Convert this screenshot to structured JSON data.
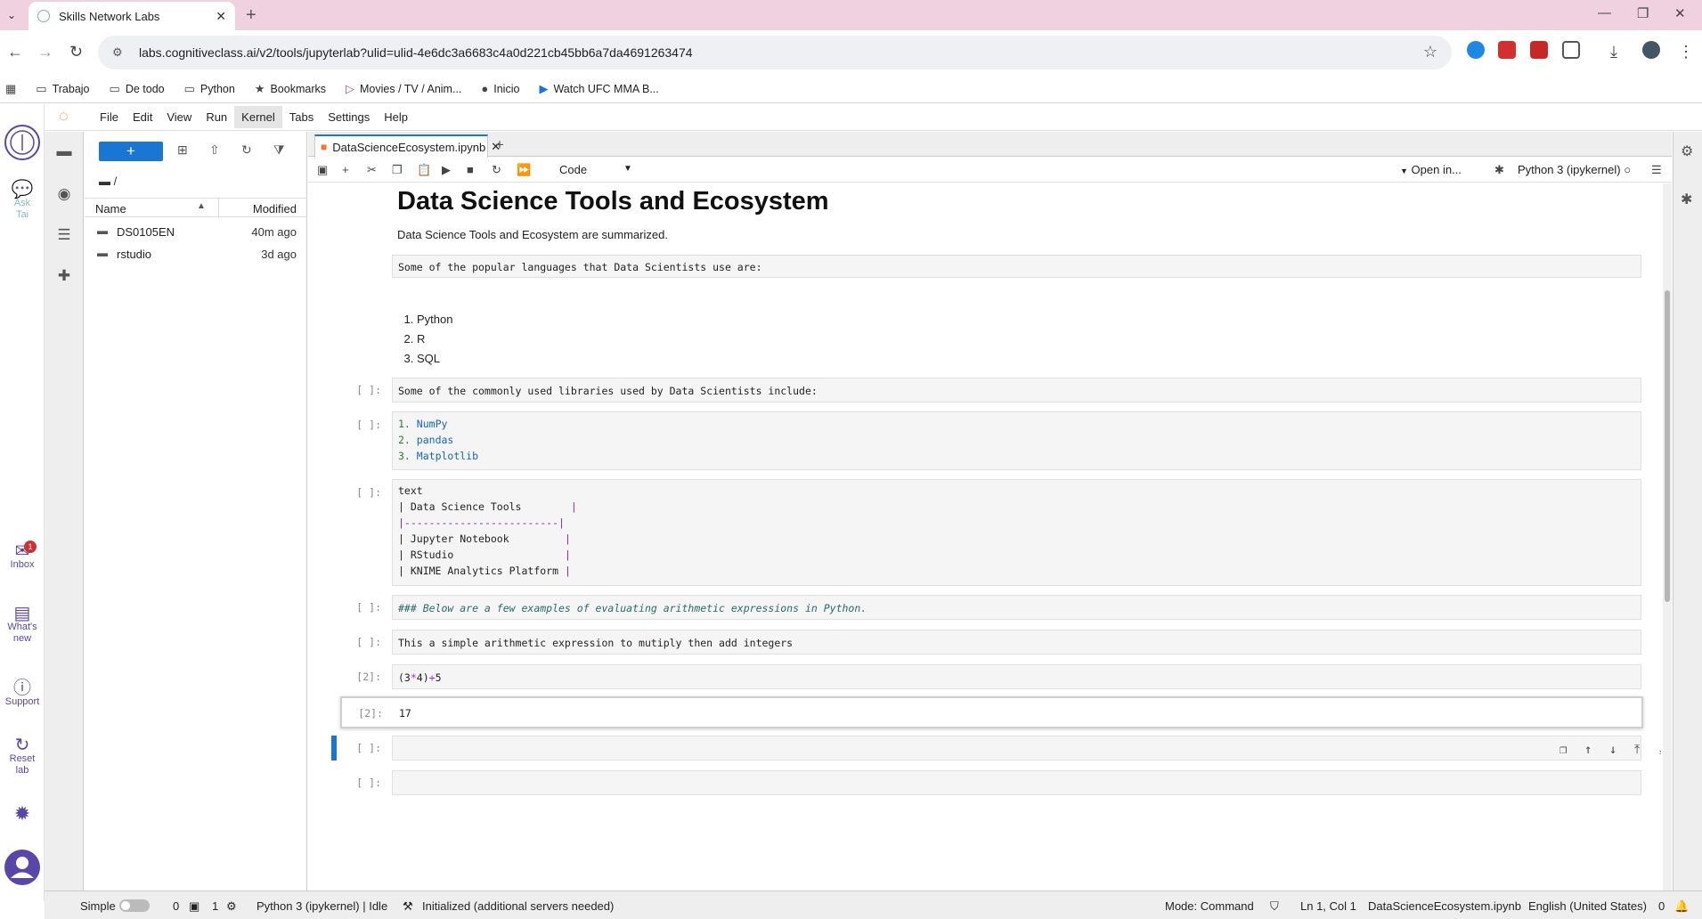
{
  "browser": {
    "tab_title": "Skills Network Labs",
    "url": "labs.cognitiveclass.ai/v2/tools/jupyterlab?ulid=ulid-4e6dc3a6683c4a0d221cb45bb6a7da4691263474",
    "bookmarks": [
      "Trabajo",
      "De todo",
      "Python",
      "Bookmarks",
      "Movies / TV / Anim...",
      "Inicio",
      "Watch UFC MMA B..."
    ]
  },
  "sn_sidebar": {
    "ask": "Ask\nTai",
    "inbox": "Inbox",
    "inbox_badge": "1",
    "whats_new": "What's\nnew",
    "support": "Support",
    "reset": "Reset\nlab"
  },
  "menu": [
    "File",
    "Edit",
    "View",
    "Run",
    "Kernel",
    "Tabs",
    "Settings",
    "Help"
  ],
  "filebrowser": {
    "new_label": "+",
    "path": "/",
    "col_name": "Name",
    "col_modified": "Modified",
    "rows": [
      {
        "name": "DS0105EN",
        "modified": "40m ago"
      },
      {
        "name": "rstudio",
        "modified": "3d ago"
      }
    ]
  },
  "notebook": {
    "tab_title": "DataScienceEcosystem.ipynb",
    "cell_type": "Code",
    "open_in": "Open in...",
    "kernel": "Python 3 (ipykernel)",
    "h1": "Data Science Tools and Ecosystem",
    "intro": "Data Science Tools and Ecosystem are summarized.",
    "languages_heading": "Some of the popular languages that Data Scientists use are:",
    "languages": [
      "Python",
      "R",
      "SQL"
    ],
    "cells": {
      "libs_prompt": "[ ]:",
      "libs_text": "Some of the commonly used libraries used by Data Scientists include:",
      "liblist_prompt": "[ ]:",
      "liblist": [
        {
          "num": "1.",
          "name": "NumPy"
        },
        {
          "num": "2.",
          "name": "pandas"
        },
        {
          "num": "3.",
          "name": "Matplotlib"
        }
      ],
      "table_prompt": "[ ]:",
      "table_word": "text",
      "table_header": "| Data Science Tools",
      "table_rule": "|-------------------------|",
      "table_rows": [
        "| Jupyter Notebook",
        "| RStudio",
        "| KNIME Analytics Platform"
      ],
      "arith_prompt": "[ ]:",
      "arith_text": "### Below are a few examples of evaluating arithmetic expressions in Python.",
      "simple_prompt": "[ ]:",
      "simple_text": "This a simple arithmetic expression to mutiply then add integers",
      "code_prompt": "[2]:",
      "code_a": "(3",
      "code_op1": "*",
      "code_b": "4)",
      "code_op2": "+",
      "code_c": "5",
      "out_prompt": "[2]:",
      "out_value": "17",
      "empty1_prompt": "[ ]:",
      "empty2_prompt": "[ ]:"
    }
  },
  "status": {
    "simple": "Simple",
    "terminals": "0",
    "kernels": "1",
    "kernel_status": "Python 3 (ipykernel) | Idle",
    "initialized": "Initialized (additional servers needed)",
    "mode": "Mode: Command",
    "position": "Ln 1, Col 1",
    "file": "DataScienceEcosystem.ipynb",
    "language": "English (United States)",
    "notifications": "0"
  },
  "colors": {
    "accent": "#1976d2",
    "jupyter_orange": "#f37726",
    "chrome_tab": "#efd1e0",
    "sn_purple": "#5a46a8"
  }
}
